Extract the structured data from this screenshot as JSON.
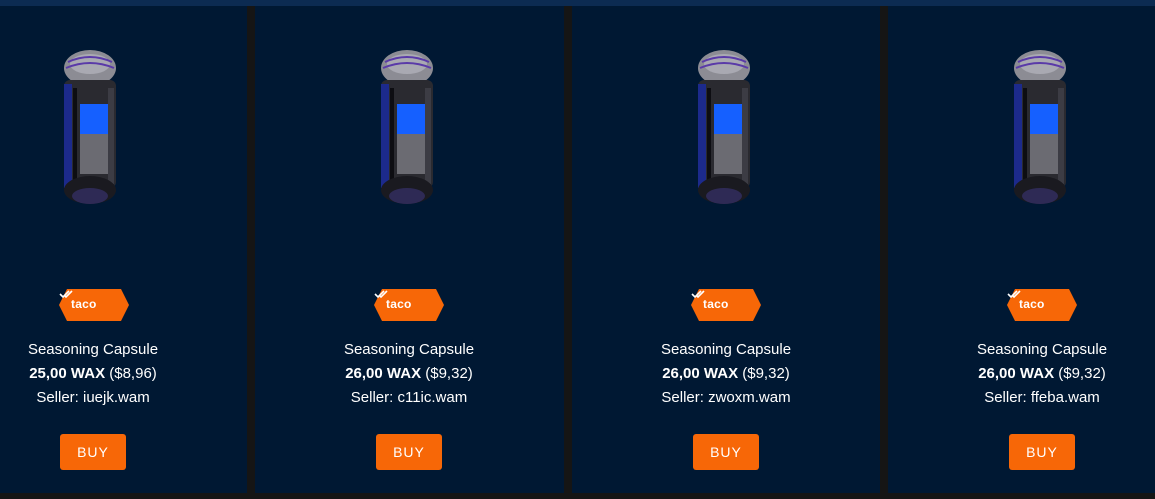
{
  "listings": [
    {
      "collection_badge": "taco",
      "name": "Seasoning Capsule",
      "price_wax": "25,00 WAX",
      "price_usd": "($8,96)",
      "seller": "Seller: iuejk.wam",
      "buy_label": "BUY"
    },
    {
      "collection_badge": "taco",
      "name": "Seasoning Capsule",
      "price_wax": "26,00 WAX",
      "price_usd": "($9,32)",
      "seller": "Seller: c11ic.wam",
      "buy_label": "BUY"
    },
    {
      "collection_badge": "taco",
      "name": "Seasoning Capsule",
      "price_wax": "26,00 WAX",
      "price_usd": "($9,32)",
      "seller": "Seller: zwoxm.wam",
      "buy_label": "BUY"
    },
    {
      "collection_badge": "taco",
      "name": "Seasoning Capsule",
      "price_wax": "26,00 WAX",
      "price_usd": "($9,32)",
      "seller": "Seller: ffeba.wam",
      "buy_label": "BUY"
    }
  ],
  "icons": {
    "item_image": "capsule-image",
    "verified": "double-check-icon"
  },
  "colors": {
    "card_background": "#001833",
    "accent": "#f76707",
    "text": "#ffffff",
    "gutter": "#151515"
  }
}
